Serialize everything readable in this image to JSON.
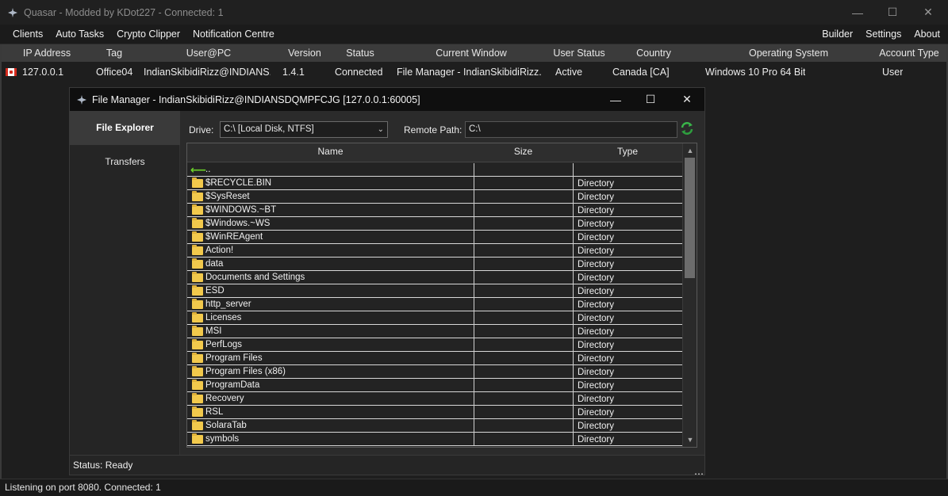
{
  "main_window": {
    "title": "Quasar - Modded by KDot227 - Connected: 1",
    "controls": {
      "minimize": "—",
      "maximize": "☐",
      "close": "✕"
    }
  },
  "menu": {
    "left": [
      "Clients",
      "Auto Tasks",
      "Crypto Clipper",
      "Notification Centre"
    ],
    "right": [
      "Builder",
      "Settings",
      "About"
    ]
  },
  "clients": {
    "columns": [
      "IP Address",
      "Tag",
      "User@PC",
      "Version",
      "Status",
      "Current Window",
      "User Status",
      "Country",
      "Operating System",
      "Account Type"
    ],
    "rows": [
      {
        "ip": "127.0.0.1",
        "tag": "Office04",
        "user_pc": "IndianSkibidiRizz@INDIANS...",
        "version": "1.4.1",
        "status": "Connected",
        "current_window": "File Manager - IndianSkibidiRizz...",
        "user_status": "Active",
        "country": "Canada [CA]",
        "os": "Windows 10 Pro 64 Bit",
        "account_type": "User"
      }
    ]
  },
  "file_manager": {
    "title": "File Manager - IndianSkibidiRizz@INDIANSDQMPFCJG [127.0.0.1:60005]",
    "tabs": [
      "File Explorer",
      "Transfers"
    ],
    "drive_label": "Drive:",
    "drive_value": "C:\\ [Local Disk, NTFS]",
    "remote_path_label": "Remote Path:",
    "remote_path_value": "C:\\",
    "columns": {
      "name": "Name",
      "size": "Size",
      "type": "Type"
    },
    "parent_entry": "..",
    "entries": [
      {
        "name": "$RECYCLE.BIN",
        "type": "Directory"
      },
      {
        "name": "$SysReset",
        "type": "Directory"
      },
      {
        "name": "$WINDOWS.~BT",
        "type": "Directory"
      },
      {
        "name": "$Windows.~WS",
        "type": "Directory"
      },
      {
        "name": "$WinREAgent",
        "type": "Directory"
      },
      {
        "name": "Action!",
        "type": "Directory"
      },
      {
        "name": "data",
        "type": "Directory"
      },
      {
        "name": "Documents and Settings",
        "type": "Directory"
      },
      {
        "name": "ESD",
        "type": "Directory"
      },
      {
        "name": "http_server",
        "type": "Directory"
      },
      {
        "name": "Licenses",
        "type": "Directory"
      },
      {
        "name": "MSI",
        "type": "Directory"
      },
      {
        "name": "PerfLogs",
        "type": "Directory"
      },
      {
        "name": "Program Files",
        "type": "Directory"
      },
      {
        "name": "Program Files (x86)",
        "type": "Directory"
      },
      {
        "name": "ProgramData",
        "type": "Directory"
      },
      {
        "name": "Recovery",
        "type": "Directory"
      },
      {
        "name": "RSL",
        "type": "Directory"
      },
      {
        "name": "SolaraTab",
        "type": "Directory"
      },
      {
        "name": "symbols",
        "type": "Directory"
      }
    ],
    "status": "Status: Ready"
  },
  "bottom_status": "Listening on port 8080.  Connected: 1"
}
